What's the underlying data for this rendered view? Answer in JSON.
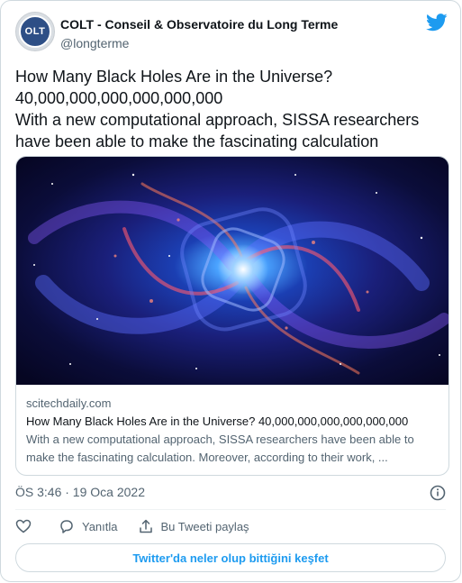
{
  "author": {
    "name": "COLT - Conseil & Observatoire du Long Terme",
    "handle": "@longterme",
    "avatar_text": "OLT"
  },
  "tweet": {
    "lines": [
      "How Many Black Holes Are in the Universe?",
      "40,000,000,000,000,000,000",
      "With a new computational approach, SISSA researchers",
      "have been able to make the fascinating calculation"
    ]
  },
  "link_card": {
    "domain": "scitechdaily.com",
    "title": "How Many Black Holes Are in the Universe? 40,000,000,000,000,000,000",
    "description": "With a new computational approach, SISSA researchers have been able to make the fascinating calculation. Moreover, according to their work, ..."
  },
  "timestamp": "ÖS 3:46 · 19 Oca 2022",
  "actions": {
    "reply_label": "Yanıtla",
    "share_label": "Bu Tweeti paylaş"
  },
  "explore_label": "Twitter'da neler olup bittiğini keşfet",
  "colors": {
    "accent": "#1d9bf0",
    "text": "#0f1419",
    "muted": "#536471",
    "border": "#cfd9de"
  },
  "icons": [
    "twitter-bird-icon",
    "info-icon",
    "heart-icon",
    "reply-icon",
    "share-icon"
  ]
}
